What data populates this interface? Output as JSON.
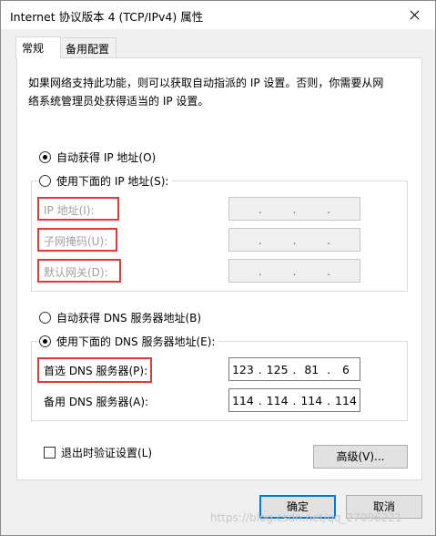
{
  "window": {
    "title": "Internet 协议版本 4 (TCP/IPv4) 属性"
  },
  "tabs": [
    {
      "label": "常规",
      "active": true
    },
    {
      "label": "备用配置",
      "active": false
    }
  ],
  "intro_text": {
    "line1": "如果网络支持此功能，则可以获取自动指派的 IP 设置。否则，你需要从网",
    "line2": "络系统管理员处获得适当的 IP 设置。"
  },
  "ip_section": {
    "auto_label": "自动获得 IP 地址(O)",
    "manual_label": "使用下面的 IP 地址(S):",
    "selected": "auto",
    "fields": [
      {
        "label": "IP 地址(I):",
        "value": [
          "",
          "",
          "",
          ""
        ]
      },
      {
        "label": "子网掩码(U):",
        "value": [
          "",
          "",
          "",
          ""
        ]
      },
      {
        "label": "默认网关(D):",
        "value": [
          "",
          "",
          "",
          ""
        ]
      }
    ]
  },
  "dns_section": {
    "auto_label": "自动获得 DNS 服务器地址(B)",
    "manual_label": "使用下面的 DNS 服务器地址(E):",
    "selected": "manual",
    "preferred": {
      "label": "首选 DNS 服务器(P):",
      "value": [
        "123",
        "125",
        "81",
        "6"
      ]
    },
    "alternate": {
      "label": "备用 DNS 服务器(A):",
      "value": [
        "114",
        "114",
        "114",
        "114"
      ]
    }
  },
  "validate_on_exit": {
    "label": "退出时验证设置(L)",
    "checked": false
  },
  "buttons": {
    "advanced": "高级(V)...",
    "ok": "确定",
    "cancel": "取消"
  },
  "watermark": "https://blog.csdn.net/qq_27096221",
  "colors": {
    "highlight_box": "#e53935",
    "primary_button_border": "#0078d7"
  }
}
